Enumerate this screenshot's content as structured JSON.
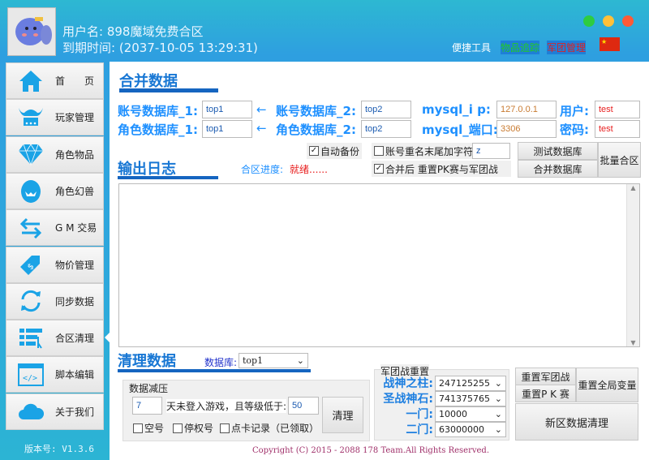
{
  "header": {
    "username_label": "用户名:",
    "username": "898魔域免费合区",
    "expire_label": "到期时间:",
    "expire": "(2037-10-05 13:29:31)",
    "links": [
      {
        "label": "便捷工具",
        "color": "#ffffff"
      },
      {
        "label": "物品追踪",
        "color": "#22cc22"
      },
      {
        "label": "军团管理",
        "color": "#dd2222"
      }
    ],
    "window_dots": [
      "#2ecc40",
      "#ffc03a",
      "#ff5a36"
    ]
  },
  "sidebar": {
    "items": [
      {
        "label": "首　　页",
        "icon": "home-icon"
      },
      {
        "label": "玩家管理",
        "icon": "viking-helmet-icon"
      },
      {
        "label": "角色物品",
        "icon": "diamond-icon"
      },
      {
        "label": "角色幻兽",
        "icon": "egg-icon"
      },
      {
        "label": "G M 交易",
        "icon": "swap-arrows-icon"
      },
      {
        "label": "物价管理",
        "icon": "price-tag-icon"
      },
      {
        "label": "同步数据",
        "icon": "sync-icon"
      },
      {
        "label": "合区清理",
        "icon": "list-cleanup-icon"
      },
      {
        "label": "脚本编辑",
        "icon": "code-window-icon"
      },
      {
        "label": "关于我们",
        "icon": "cloud-icon"
      }
    ],
    "version": "版本号: V1.3.6"
  },
  "merge": {
    "title": "合并数据",
    "acct1_label": "账号数据库_1:",
    "acct1": "top1",
    "acct2_label": "账号数据库_2:",
    "acct2": "top2",
    "role1_label": "角色数据库_1:",
    "role1": "top1",
    "role2_label": "角色数据库_2:",
    "role2": "top2",
    "arrow": "←",
    "ip_label": "mysql_i  p:",
    "ip": "127.0.0.1",
    "port_label": "mysql_端口:",
    "port": "3306",
    "user_label": "用户:",
    "user": "test",
    "pwd_label": "密码:",
    "pwd": "test",
    "auto_backup": "自动备份",
    "suffix_label": "账号重名末尾加字符",
    "suffix": "z",
    "reset_pk": "合并后 重置PK赛与军团战",
    "test_db": "测试数据库",
    "merge_db": "合并数据库",
    "batch": "批量合区"
  },
  "log": {
    "title": "输出日志",
    "progress_label": "合区进度:",
    "progress": "就绪......"
  },
  "clean": {
    "title": "清理数据",
    "db_label": "数据库:",
    "db": "top1",
    "compress_title": "数据减压",
    "days": "7",
    "days_text": "天未登入游戏，且等级低于:",
    "level": "50",
    "clean_btn": "清理",
    "empty": "空号",
    "banned": "停权号",
    "card": "点卡记录（已领取）"
  },
  "legion": {
    "title": "军团战重置",
    "rows": [
      {
        "label": "战神之柱:",
        "value": "247125255"
      },
      {
        "label": "圣战神石:",
        "value": "741375765"
      },
      {
        "label": "一门:",
        "value": "10000"
      },
      {
        "label": "二门:",
        "value": "63000000"
      }
    ]
  },
  "actions": {
    "reset_legion": "重置军团战",
    "reset_pk": "重置P K 赛",
    "reset_global": "重置全局变量",
    "new_clean": "新区数据清理"
  },
  "footer": {
    "copyright": "Copyright (C) 2015 - 2088 178 Team.All Rights Reserved."
  }
}
